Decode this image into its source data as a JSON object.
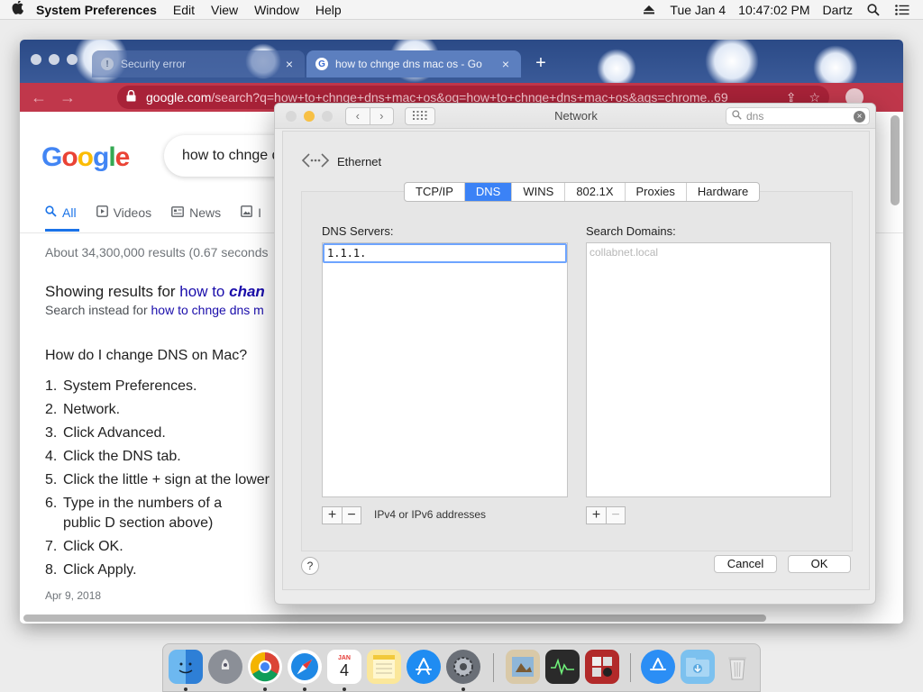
{
  "menubar": {
    "app_name": "System Preferences",
    "menus": [
      "Edit",
      "View",
      "Window",
      "Help"
    ],
    "date": "Tue Jan 4",
    "time": "10:47:02 PM",
    "user": "Dartz"
  },
  "browser": {
    "tabs": [
      {
        "label": "Security error"
      },
      {
        "label": "how to chnge dns mac os - Go"
      }
    ],
    "url_domain": "google.com",
    "url_path": "/search?q=how+to+chnge+dns+mac+os&oq=how+to+chnge+dns+mac+os&aqs=chrome..69"
  },
  "google": {
    "logo": "Google",
    "query": "how to chnge d",
    "tabs": [
      {
        "label": "All",
        "icon": "search-icon"
      },
      {
        "label": "Videos",
        "icon": "play-icon"
      },
      {
        "label": "News",
        "icon": "news-icon"
      },
      {
        "label": "I",
        "icon": "image-icon"
      }
    ],
    "stats": "About 34,300,000 results (0.67 seconds",
    "showing_prefix": "Showing results for ",
    "showing_query_plain": "how to ",
    "showing_query_bold": "chan",
    "instead_prefix": "Search instead for ",
    "instead_link": "how to chnge dns m",
    "question": "How do I change DNS on Mac?",
    "steps": [
      {
        "n": "1.",
        "text": "System Preferences."
      },
      {
        "n": "2.",
        "text": "Network."
      },
      {
        "n": "3.",
        "text": "Click Advanced."
      },
      {
        "n": "4.",
        "text": "Click the DNS tab."
      },
      {
        "n": "5.",
        "text": "Click the little + sign at the lower"
      },
      {
        "n": "6.",
        "text": "Type in the numbers of a public D section above)"
      },
      {
        "n": "7.",
        "text": "Click OK."
      },
      {
        "n": "8.",
        "text": "Click Apply."
      }
    ],
    "date": "Apr 9, 2018"
  },
  "network": {
    "title": "Network",
    "search_value": "dns",
    "interface": "Ethernet",
    "tabs": [
      "TCP/IP",
      "DNS",
      "WINS",
      "802.1X",
      "Proxies",
      "Hardware"
    ],
    "selected_tab": "DNS",
    "dns_label": "DNS Servers:",
    "dns_value": "1.1.1.",
    "domains_label": "Search Domains:",
    "domains_placeholder": "collabnet.local",
    "hint": "IPv4 or IPv6 addresses",
    "help": "?",
    "cancel": "Cancel",
    "ok": "OK"
  },
  "dock": {
    "calendar_month": "JAN",
    "calendar_day": "4"
  },
  "colors": {
    "accent": "#3b82f6",
    "chrome_toolbar": "#c0374b",
    "google_blue": "#4285f4",
    "google_red": "#ea4335",
    "google_yellow": "#fbbc05",
    "google_green": "#34a853"
  }
}
